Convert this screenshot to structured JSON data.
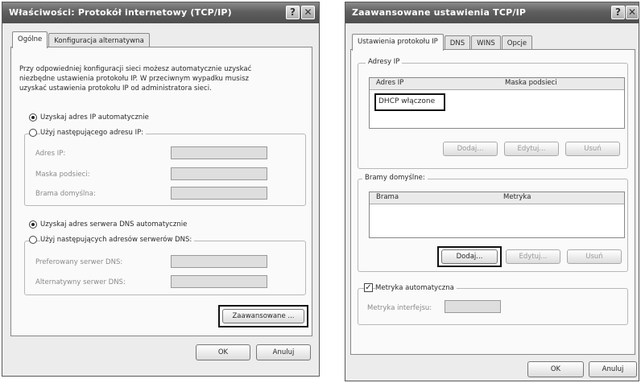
{
  "left_dialog": {
    "title": "Właściwości: Protokół internetowy (TCP/IP)",
    "help_glyph": "?",
    "close_glyph": "✕",
    "tabs": [
      "Ogólne",
      "Konfiguracja alternatywna"
    ],
    "intro_line1": "Przy odpowiedniej konfiguracji sieci możesz automatycznie uzyskać",
    "intro_line2": "niezbędne ustawienia protokołu IP. W przeciwnym wypadku musisz",
    "intro_line3": "uzyskać ustawienia protokołu IP od administratora sieci.",
    "radio_auto_ip": "Uzyskaj adres IP automatycznie",
    "radio_manual_ip": "Użyj następującego adresu IP:",
    "label_ip": "Adres IP:",
    "label_mask": "Maska podsieci:",
    "label_gateway": "Brama domyślna:",
    "radio_auto_dns": "Uzyskaj adres serwera DNS automatycznie",
    "radio_manual_dns": "Użyj następujących adresów serwerów DNS:",
    "label_pref_dns": "Preferowany serwer DNS:",
    "label_alt_dns": "Alternatywny serwer DNS:",
    "advanced_button": "Zaawansowane ...",
    "ok_button": "OK",
    "cancel_button": "Anuluj"
  },
  "right_dialog": {
    "title": "Zaawansowane ustawienia TCP/IP",
    "help_glyph": "?",
    "close_glyph": "✕",
    "tabs": [
      "Ustawienia protokołu IP",
      "DNS",
      "WINS",
      "Opcje"
    ],
    "group_ip": "Adresy IP",
    "col_ip": "Adres IP",
    "col_mask": "Maska podsieci",
    "dhcp_item": "DHCP włączone",
    "add_button": "Dodaj...",
    "edit_button": "Edytuj...",
    "remove_button": "Usuń",
    "group_gateways": "Bramy domyślne:",
    "col_gateway": "Brama",
    "col_metric": "Metryka",
    "auto_metric_label": "Metryka automatyczna",
    "auto_metric_checked": "✓",
    "interface_metric_label": "Metryka interfejsu:",
    "ok_button": "OK",
    "cancel_button": "Anuluj"
  }
}
